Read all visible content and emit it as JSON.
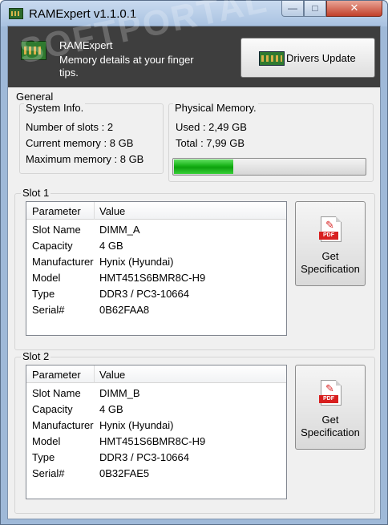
{
  "window": {
    "title": "RAMExpert v1.1.0.1",
    "min_symbol": "—",
    "max_symbol": "□",
    "close_symbol": "✕"
  },
  "banner": {
    "app_name": "RAMExpert",
    "tagline": "Memory details at your finger tips.",
    "drivers_button": "Drivers Update",
    "watermark": "SOFTPORTAL"
  },
  "general": {
    "group_label": "General",
    "system_info": {
      "label": "System Info.",
      "number_of_slots": "Number of slots : 2",
      "current_memory": "Current memory : 8 GB",
      "maximum_memory": "Maximum memory : 8 GB"
    },
    "physical_memory": {
      "label": "Physical Memory.",
      "used": "Used : 2,49 GB",
      "total": "Total : 7,99 GB",
      "usage_fraction": 0.31
    }
  },
  "slots": [
    {
      "label": "Slot 1",
      "columns": [
        "Parameter",
        "Value"
      ],
      "rows": [
        {
          "param": "Slot Name",
          "value": "DIMM_A"
        },
        {
          "param": "Capacity",
          "value": "4 GB"
        },
        {
          "param": "Manufacturer",
          "value": "Hynix (Hyundai)"
        },
        {
          "param": "Model",
          "value": "HMT451S6BMR8C-H9"
        },
        {
          "param": "Type",
          "value": "DDR3 / PC3-10664"
        },
        {
          "param": "Serial#",
          "value": "0B62FAA8"
        }
      ],
      "spec_button": {
        "pdf_badge": "PDF",
        "line1": "Get",
        "line2": "Specification"
      }
    },
    {
      "label": "Slot 2",
      "columns": [
        "Parameter",
        "Value"
      ],
      "rows": [
        {
          "param": "Slot Name",
          "value": "DIMM_B"
        },
        {
          "param": "Capacity",
          "value": "4 GB"
        },
        {
          "param": "Manufacturer",
          "value": "Hynix (Hyundai)"
        },
        {
          "param": "Model",
          "value": "HMT451S6BMR8C-H9"
        },
        {
          "param": "Type",
          "value": "DDR3 / PC3-10664"
        },
        {
          "param": "Serial#",
          "value": "0B32FAE5"
        }
      ],
      "spec_button": {
        "pdf_badge": "PDF",
        "line1": "Get",
        "line2": "Specification"
      }
    }
  ],
  "colors": {
    "banner_bg": "#3e3e3e",
    "progress_green": "#16b016",
    "pdf_red": "#d81f1f"
  }
}
